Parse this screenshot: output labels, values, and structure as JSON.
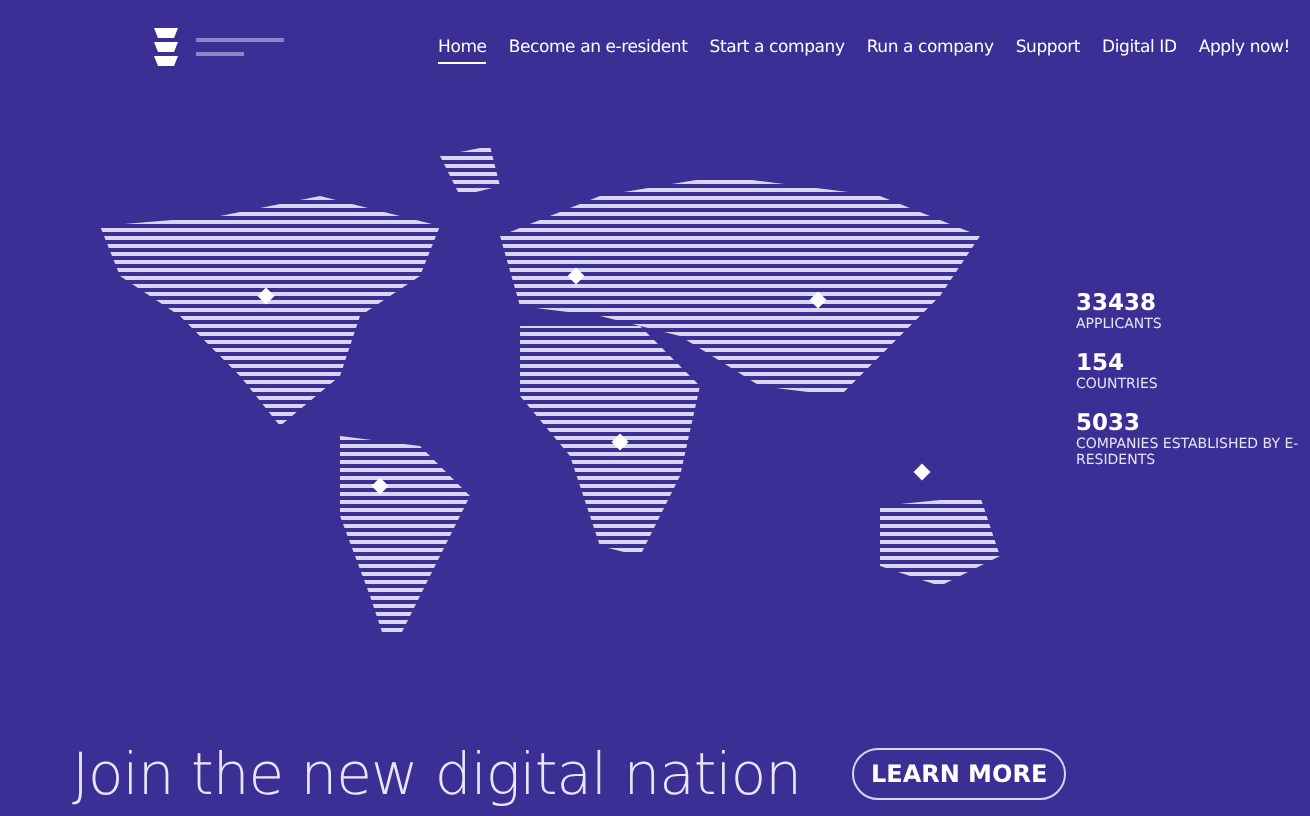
{
  "nav": {
    "items": [
      {
        "label": "Home",
        "selected": true
      },
      {
        "label": "Become an e-resident",
        "selected": false
      },
      {
        "label": "Start a company",
        "selected": false
      },
      {
        "label": "Run a company",
        "selected": false
      },
      {
        "label": "Support",
        "selected": false
      },
      {
        "label": "Digital ID",
        "selected": false
      },
      {
        "label": "Apply now!",
        "selected": false
      }
    ]
  },
  "stats": [
    {
      "value": "33438",
      "label": "APPLICANTS"
    },
    {
      "value": "154",
      "label": "COUNTRIES"
    },
    {
      "value": "5033",
      "label": "COMPANIES ESTABLISHED BY E-RESIDENTS"
    }
  ],
  "headline": "Join the new digital nation",
  "cta": "LEARN MORE"
}
